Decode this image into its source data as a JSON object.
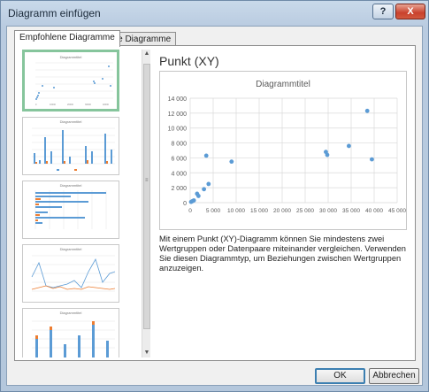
{
  "window": {
    "title": "Diagramm einfügen",
    "help_label": "?",
    "close_label": "X"
  },
  "tabs": [
    {
      "label": "Empfohlene Diagramme",
      "active": true
    },
    {
      "label": "Alle Diagramme",
      "active": false
    }
  ],
  "thumbnails": [
    {
      "title": "Diagrammtitel",
      "kind": "scatter",
      "selected": true
    },
    {
      "title": "Diagrammtitel",
      "kind": "column"
    },
    {
      "title": "Diagrammtitel",
      "kind": "bar"
    },
    {
      "title": "Diagrammtitel",
      "kind": "line"
    },
    {
      "title": "Diagrammtitel",
      "kind": "stacked-column"
    }
  ],
  "preview": {
    "type_title": "Punkt (XY)",
    "description": "Mit einem Punkt (XY)-Diagramm können Sie mindestens zwei Wertgruppen oder Datenpaare miteinander vergleichen. Verwenden Sie diesen Diagrammtyp, um Beziehungen zwischen Wertgruppen anzuzeigen."
  },
  "chart_data": {
    "type": "scatter",
    "title": "Diagrammtitel",
    "xlabel": "",
    "ylabel": "",
    "xlim": [
      0,
      45000
    ],
    "ylim": [
      0,
      14000
    ],
    "x_ticks": [
      "0",
      "5 000",
      "10 000",
      "15 000",
      "20 000",
      "25 000",
      "30 000",
      "35 000",
      "40 000",
      "45 000"
    ],
    "y_ticks": [
      "0",
      "2 000",
      "4 000",
      "6 000",
      "8 000",
      "10 000",
      "12 000",
      "14 000"
    ],
    "grid": true,
    "color": "#5b9bd5",
    "series": [
      {
        "x": [
          200,
          500,
          800,
          1500,
          1800,
          3000,
          3500,
          4000,
          9000,
          29500,
          29800,
          34500,
          38500,
          39500
        ],
        "y": [
          100,
          200,
          300,
          1200,
          900,
          1800,
          6300,
          2500,
          5500,
          6800,
          6400,
          7600,
          12300,
          5800
        ]
      }
    ]
  },
  "buttons": {
    "ok": "OK",
    "cancel": "Abbrechen"
  },
  "scrollbar": {
    "up": "▲",
    "down": "▼",
    "grip": "≡"
  }
}
